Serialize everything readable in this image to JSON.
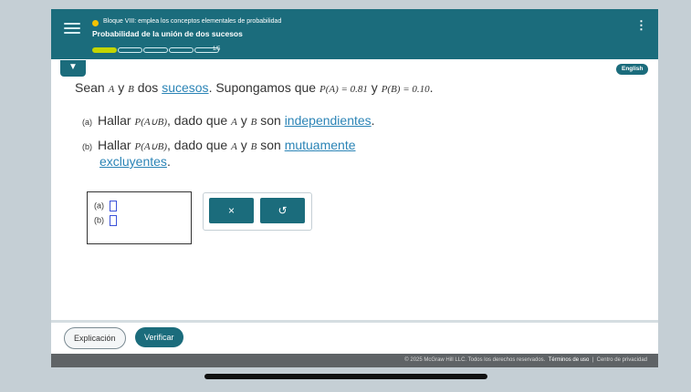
{
  "header": {
    "block_title": "Bloque VIII: emplea los conceptos elementales de probabilidad",
    "lesson_title": "Probabilidad de la unión de dos sucesos",
    "progress": {
      "filled": 1,
      "total": 5,
      "label": "1/5"
    },
    "english_label": "English",
    "colors": {
      "bar": "#1b6c7c",
      "progress_fill": "#c3d500",
      "bullet": "#f2c200"
    }
  },
  "question": {
    "t1": "Sean ",
    "A": "A",
    "t2": " y ",
    "B": "B",
    "t3": " dos ",
    "link_sucesos": "sucesos",
    "t4": ". Supongamos que ",
    "pA": "P(A) = 0.81",
    "t5": " y ",
    "pB": "P(B) = 0.10",
    "t6": "."
  },
  "part_a": {
    "label": "(a)",
    "t1": "Hallar ",
    "expr": "P(A∪B)",
    "t2": ", dado que ",
    "A": "A",
    "t3": " y ",
    "B": "B",
    "t4": " son ",
    "link": "independientes",
    "t5": "."
  },
  "part_b": {
    "label": "(b)",
    "t1": "Hallar ",
    "expr": "P(A∪B)",
    "t2": ", dado que ",
    "A": "A",
    "t3": " y ",
    "B": "B",
    "t4": " son ",
    "link1": "mutuamente",
    "link2": "excluyentes",
    "t5": "."
  },
  "answers": {
    "a_label": "(a)",
    "b_label": "(b)"
  },
  "tools": {
    "clear": "×",
    "undo": "↺"
  },
  "footer": {
    "explain": "Explicación",
    "verify": "Verificar",
    "copyright": "© 2025 McGraw Hill LLC. Todos los derechos reservados.",
    "terms": "Términos de uso",
    "sep": "|",
    "privacy": "Centro de privacidad"
  }
}
